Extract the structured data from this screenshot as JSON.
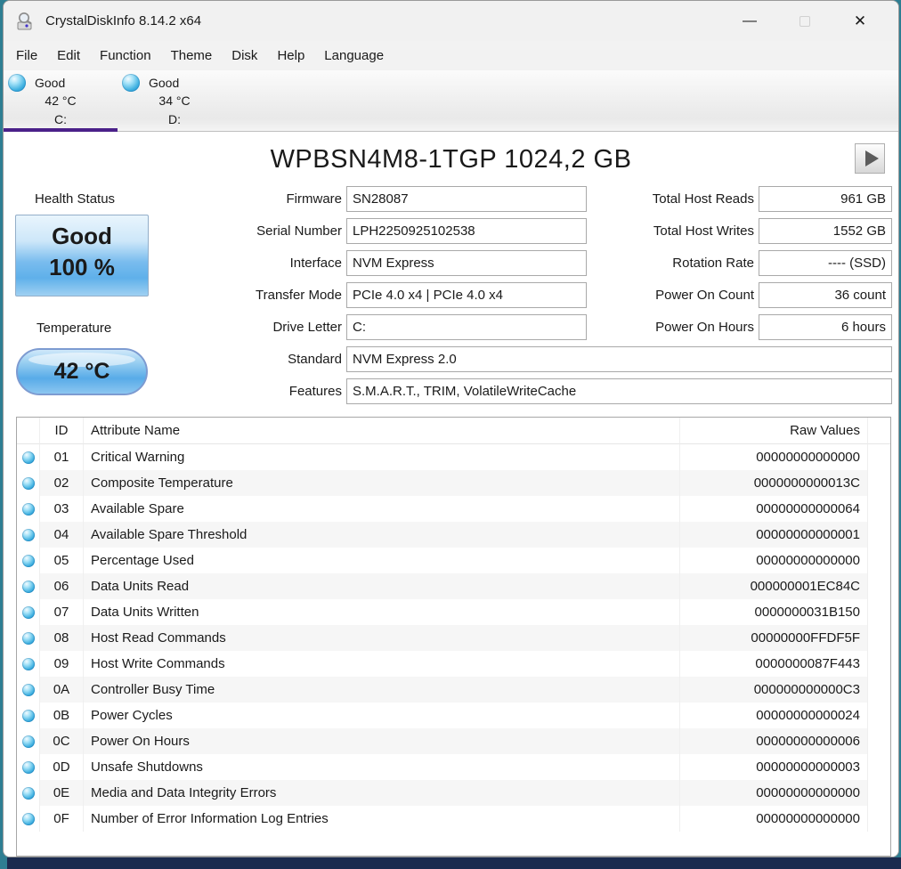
{
  "window": {
    "title": "CrystalDiskInfo 8.14.2 x64",
    "controls": {
      "minimize": "—",
      "close": "✕"
    }
  },
  "menu": {
    "items": [
      "File",
      "Edit",
      "Function",
      "Theme",
      "Disk",
      "Help",
      "Language"
    ]
  },
  "drive_tabs": [
    {
      "status": "Good",
      "temp": "42 °C",
      "letter": "C:",
      "selected": true
    },
    {
      "status": "Good",
      "temp": "34 °C",
      "letter": "D:",
      "selected": false
    }
  ],
  "drive": {
    "title": "WPBSN4M8-1TGP 1024,2 GB",
    "health": {
      "label": "Health Status",
      "status": "Good",
      "percent": "100 %"
    },
    "temperature": {
      "label": "Temperature",
      "value": "42 °C"
    },
    "fields_mid": [
      {
        "label": "Firmware",
        "value": "SN28087"
      },
      {
        "label": "Serial Number",
        "value": "LPH2250925102538"
      },
      {
        "label": "Interface",
        "value": "NVM Express"
      },
      {
        "label": "Transfer Mode",
        "value": "PCIe 4.0 x4 | PCIe 4.0 x4"
      },
      {
        "label": "Drive Letter",
        "value": "C:"
      },
      {
        "label": "Standard",
        "value": "NVM Express 2.0"
      },
      {
        "label": "Features",
        "value": "S.M.A.R.T., TRIM, VolatileWriteCache"
      }
    ],
    "fields_right": [
      {
        "label": "Total Host Reads",
        "value": "961 GB"
      },
      {
        "label": "Total Host Writes",
        "value": "1552 GB"
      },
      {
        "label": "Rotation Rate",
        "value": "---- (SSD)"
      },
      {
        "label": "Power On Count",
        "value": "36 count"
      },
      {
        "label": "Power On Hours",
        "value": "6 hours"
      }
    ]
  },
  "table": {
    "headers": {
      "id": "ID",
      "name": "Attribute Name",
      "raw": "Raw Values"
    },
    "rows": [
      {
        "id": "01",
        "name": "Critical Warning",
        "raw": "00000000000000"
      },
      {
        "id": "02",
        "name": "Composite Temperature",
        "raw": "0000000000013C"
      },
      {
        "id": "03",
        "name": "Available Spare",
        "raw": "00000000000064"
      },
      {
        "id": "04",
        "name": "Available Spare Threshold",
        "raw": "00000000000001"
      },
      {
        "id": "05",
        "name": "Percentage Used",
        "raw": "00000000000000"
      },
      {
        "id": "06",
        "name": "Data Units Read",
        "raw": "000000001EC84C"
      },
      {
        "id": "07",
        "name": "Data Units Written",
        "raw": "0000000031B150"
      },
      {
        "id": "08",
        "name": "Host Read Commands",
        "raw": "00000000FFDF5F"
      },
      {
        "id": "09",
        "name": "Host Write Commands",
        "raw": "0000000087F443"
      },
      {
        "id": "0A",
        "name": "Controller Busy Time",
        "raw": "000000000000C3"
      },
      {
        "id": "0B",
        "name": "Power Cycles",
        "raw": "00000000000024"
      },
      {
        "id": "0C",
        "name": "Power On Hours",
        "raw": "00000000000006"
      },
      {
        "id": "0D",
        "name": "Unsafe Shutdowns",
        "raw": "00000000000003"
      },
      {
        "id": "0E",
        "name": "Media and Data Integrity Errors",
        "raw": "00000000000000"
      },
      {
        "id": "0F",
        "name": "Number of Error Information Log Entries",
        "raw": "00000000000000"
      }
    ]
  },
  "colors": {
    "accent_purple": "#4b2189",
    "orb_blue": "#3fb0e0",
    "health_blue": "#5fb0ea",
    "desktop_teal": "#2e7e92",
    "bottom_navy": "#1b2b4f",
    "titlebar_gray": "#f1f1f1"
  }
}
